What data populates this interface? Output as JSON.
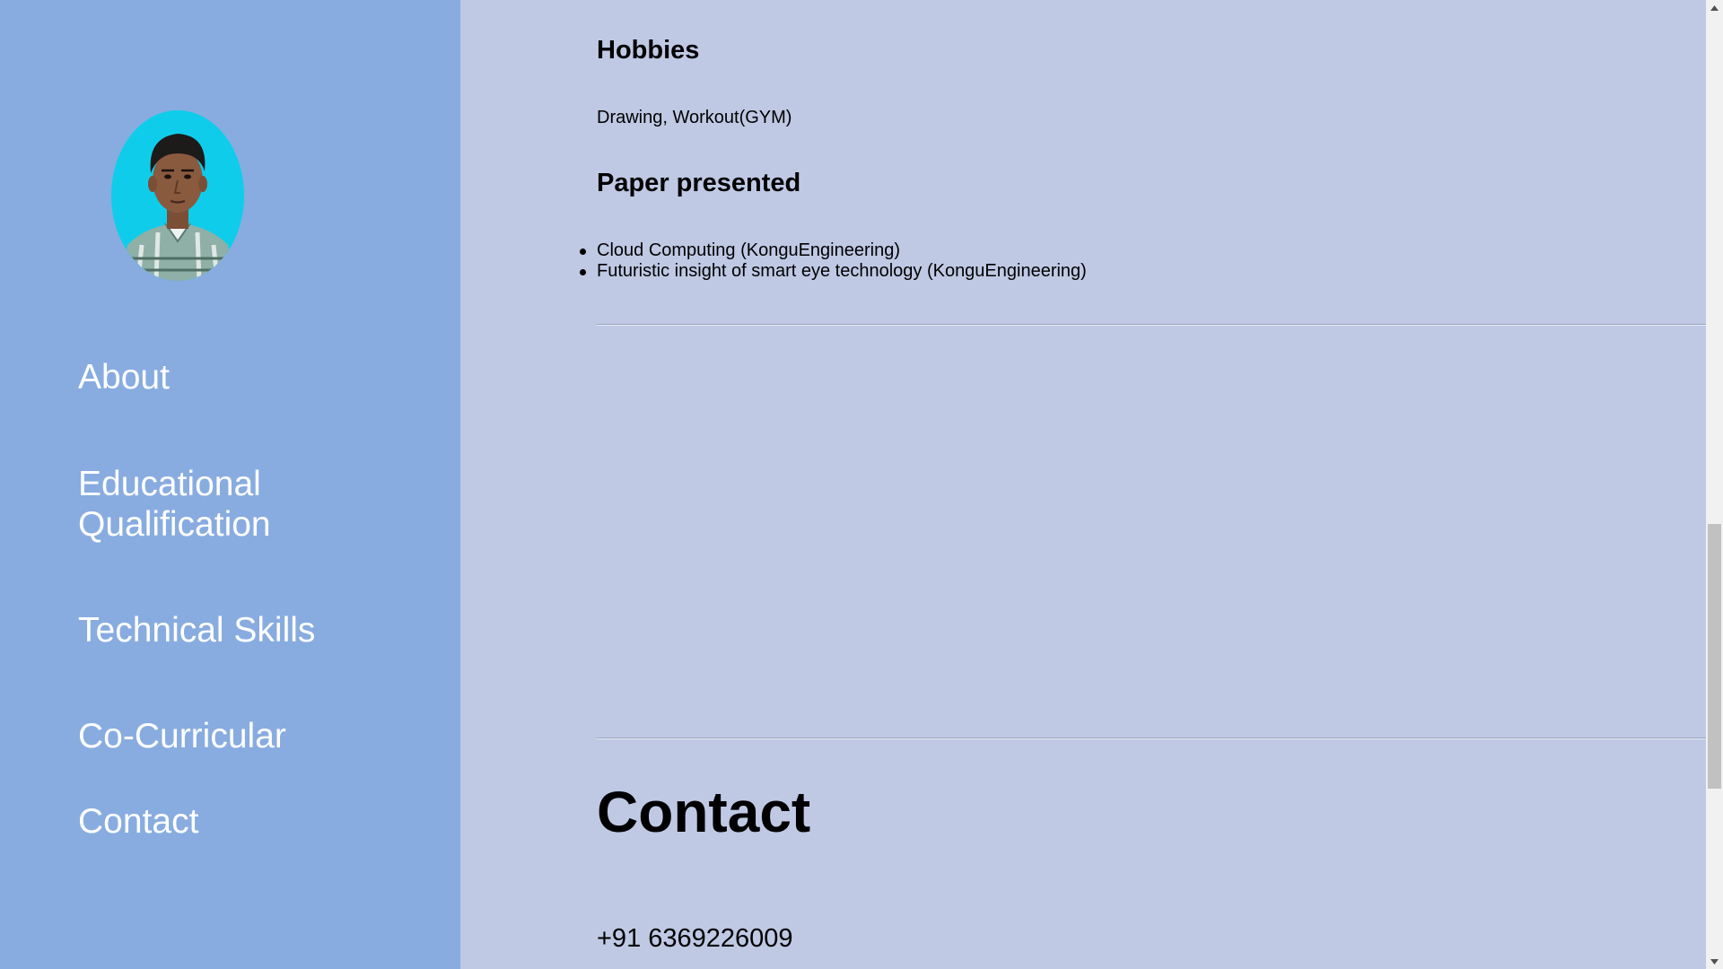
{
  "sidebar": {
    "avatar_alt": "profile photo",
    "nav": {
      "about": "About",
      "educational": "Educational Qualification",
      "technical": "Technical Skills",
      "cocurricular": "Co-Curricular",
      "contact": "Contact"
    }
  },
  "main": {
    "hobbies": {
      "heading": "Hobbies",
      "text": "Drawing, Workout(GYM)"
    },
    "papers": {
      "heading": "Paper presented",
      "items": [
        "Cloud Computing (KonguEngineering)",
        "Futuristic insight of smart eye technology (KonguEngineering)"
      ]
    },
    "contact": {
      "heading": "Contact",
      "phone": "+91 6369226009"
    }
  },
  "scrollbar": {
    "position_fraction": 0.54
  },
  "colors": {
    "sidebar_bg": "#88ace0",
    "main_bg": "#bfc9e4",
    "avatar_bg": "#0fcdea",
    "nav_text": "#ffffff"
  }
}
